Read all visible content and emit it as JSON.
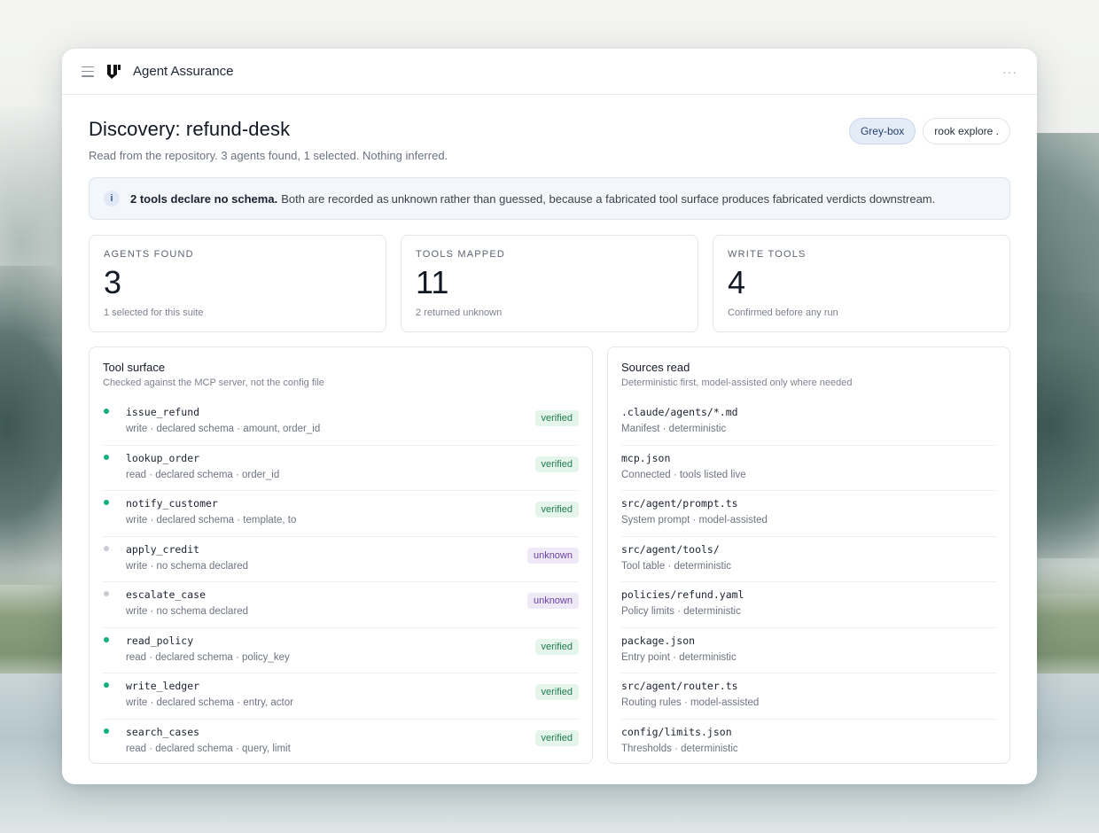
{
  "app": {
    "title": "Agent Assurance"
  },
  "page": {
    "title": "Discovery: refund-desk",
    "subtitle": "Read from the repository. 3 agents found, 1 selected. Nothing inferred.",
    "pills": {
      "mode": "Grey-box",
      "command": "rook explore ."
    }
  },
  "banner": {
    "strong": "2 tools declare no schema.",
    "text_before": "Both are recorded as",
    "code": "unknown",
    "text_after": "rather than guessed, because a fabricated tool surface produces fabricated verdicts downstream."
  },
  "stats": [
    {
      "label": "Agents found",
      "value": "3",
      "note": "1 selected for this suite"
    },
    {
      "label": "Tools mapped",
      "value": "11",
      "note": "2 returned unknown"
    },
    {
      "label": "Write tools",
      "value": "4",
      "note": "Confirmed before any run"
    }
  ],
  "tool_surface": {
    "title": "Tool surface",
    "subtitle": "Checked against the MCP server, not the config file",
    "tools": [
      {
        "name": "issue_refund",
        "desc": "write · declared schema · amount, order_id",
        "status": "verified"
      },
      {
        "name": "lookup_order",
        "desc": "read · declared schema · order_id",
        "status": "verified"
      },
      {
        "name": "notify_customer",
        "desc": "write · declared schema · template, to",
        "status": "verified"
      },
      {
        "name": "apply_credit",
        "desc": "write · no schema declared",
        "status": "unknown"
      },
      {
        "name": "escalate_case",
        "desc": "write · no schema declared",
        "status": "unknown"
      },
      {
        "name": "read_policy",
        "desc": "read · declared schema · policy_key",
        "status": "verified"
      },
      {
        "name": "write_ledger",
        "desc": "write · declared schema · entry, actor",
        "status": "verified"
      },
      {
        "name": "search_cases",
        "desc": "read · declared schema · query, limit",
        "status": "verified"
      }
    ]
  },
  "sources": {
    "title": "Sources read",
    "subtitle": "Deterministic first, model-assisted only where needed",
    "items": [
      {
        "path": ".claude/agents/*.md",
        "desc": "Manifest · deterministic"
      },
      {
        "path": "mcp.json",
        "desc": "Connected · tools listed live"
      },
      {
        "path": "src/agent/prompt.ts",
        "desc": "System prompt · model-assisted"
      },
      {
        "path": "src/agent/tools/",
        "desc": "Tool table · deterministic"
      },
      {
        "path": "policies/refund.yaml",
        "desc": "Policy limits · deterministic"
      },
      {
        "path": "package.json",
        "desc": "Entry point · deterministic"
      },
      {
        "path": "src/agent/router.ts",
        "desc": "Routing rules · model-assisted"
      },
      {
        "path": "config/limits.json",
        "desc": "Thresholds · deterministic"
      }
    ]
  },
  "colors": {
    "verified_dot": "#12b07a",
    "unknown_dot": "#c8ccd2",
    "accent": "#26406b"
  }
}
